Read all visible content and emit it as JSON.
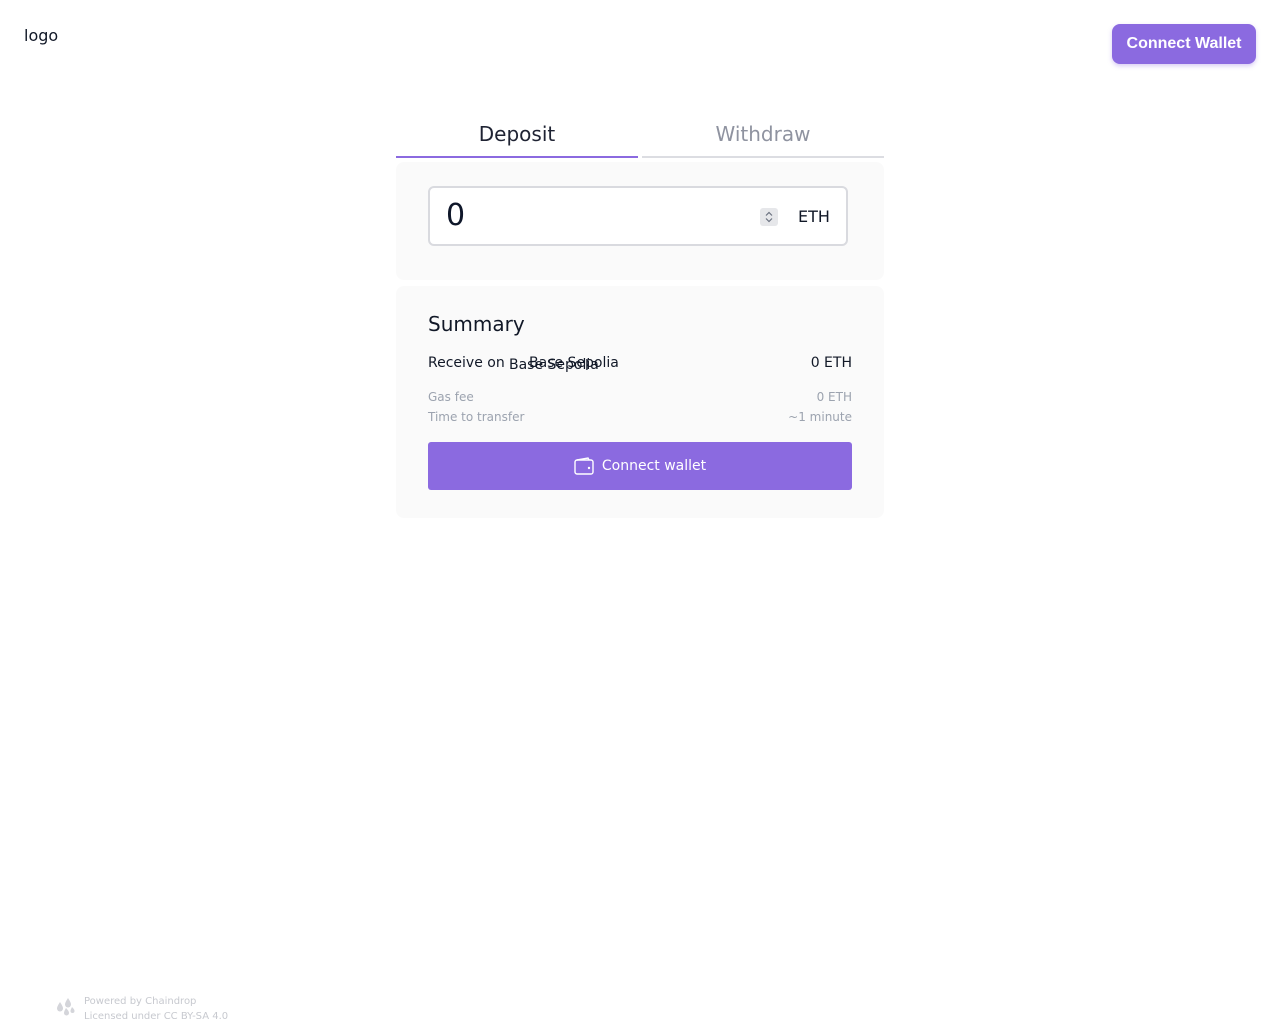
{
  "header": {
    "logo_text": "logo",
    "connect_button": "Connect Wallet"
  },
  "tabs": [
    {
      "label": "Deposit",
      "active": true
    },
    {
      "label": "Withdraw",
      "active": false
    }
  ],
  "amount": {
    "value": "0",
    "currency": "ETH"
  },
  "summary": {
    "title": "Summary",
    "receive_label": "Receive on",
    "receive_chain": "Base Sepolia",
    "receive_chain_overlay": "Base Sepolia",
    "receive_value": "0 ETH",
    "gas_fee_label": "Gas fee",
    "gas_fee_value": "0 ETH",
    "time_label": "Time to transfer",
    "time_value": "~1 minute",
    "connect_button": "Connect wallet"
  },
  "footer": {
    "powered_by": "Powered by Chaindrop",
    "license": "Licensed under CC BY-SA 4.0"
  },
  "colors": {
    "accent": "#8b6ae0",
    "card_background": "#fafafa",
    "muted_text": "#9ca3af"
  },
  "icons": {
    "wallet": "wallet-icon",
    "stepper": "chevron-updown-icon",
    "footer": "chaindrop-drops-icon"
  }
}
